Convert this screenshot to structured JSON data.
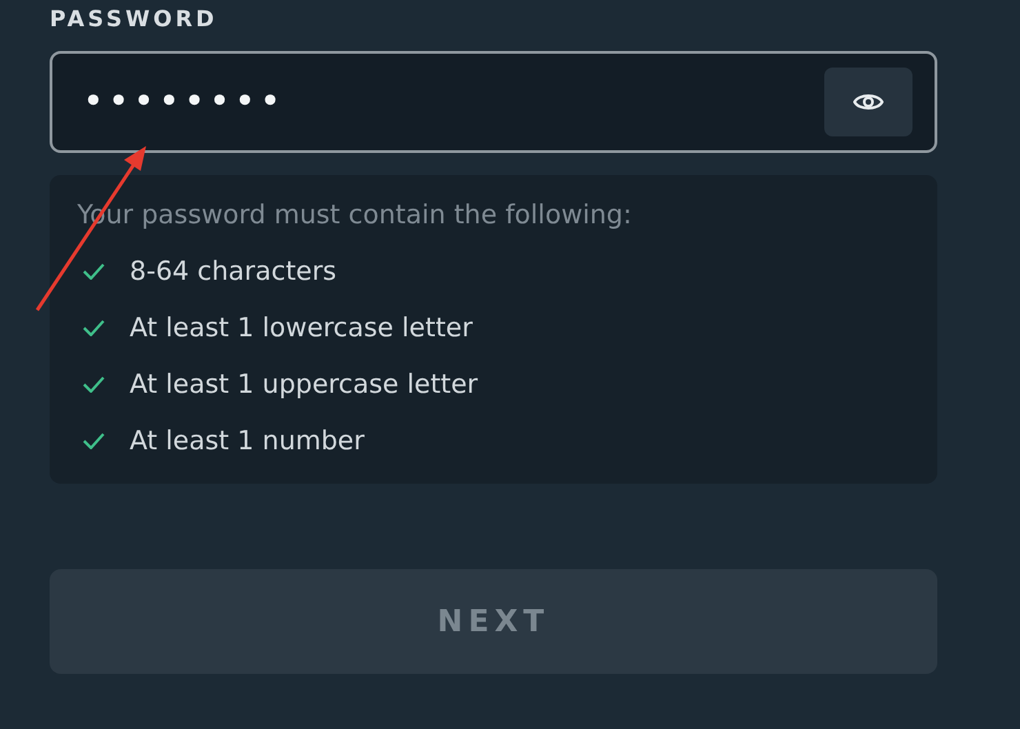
{
  "password_field": {
    "label": "PASSWORD",
    "value": "••••••••",
    "visible": false
  },
  "requirements": {
    "heading": "Your password must contain the following:",
    "items": [
      {
        "text": "8-64 characters",
        "met": true
      },
      {
        "text": "At least 1 lowercase letter",
        "met": true
      },
      {
        "text": "At least 1 uppercase letter",
        "met": true
      },
      {
        "text": "At least 1 number",
        "met": true
      }
    ]
  },
  "next_button": {
    "label": "NEXT",
    "disabled": true
  }
}
